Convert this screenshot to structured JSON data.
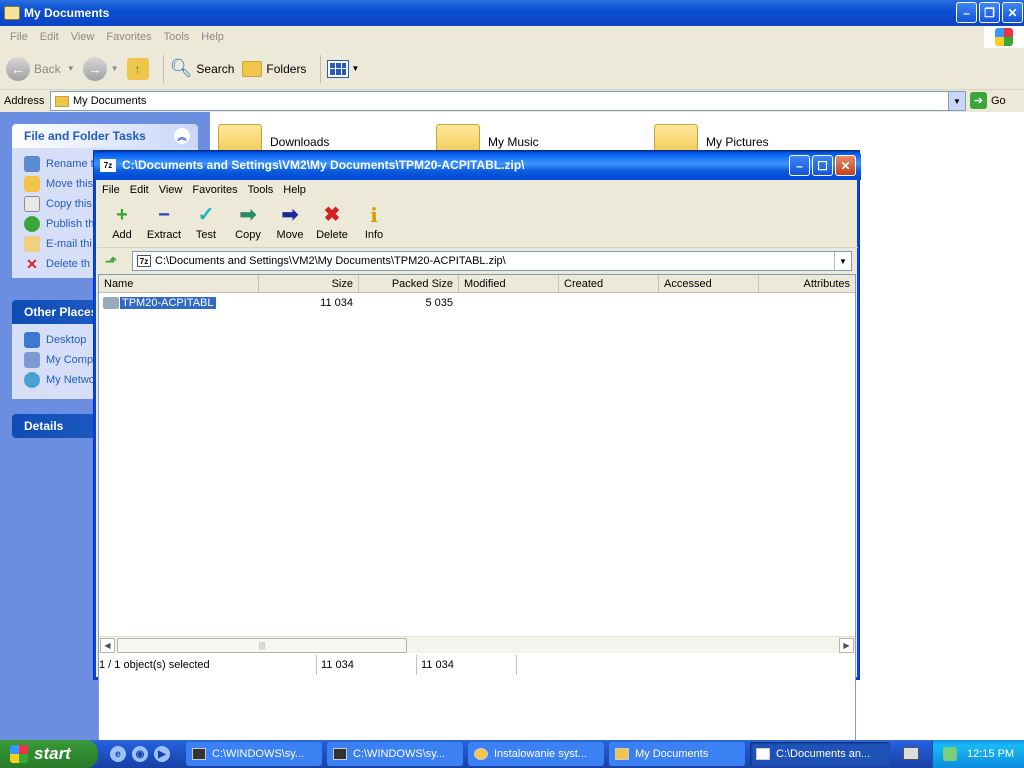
{
  "explorer": {
    "title": "My Documents",
    "menu": [
      "File",
      "Edit",
      "View",
      "Favorites",
      "Tools",
      "Help"
    ],
    "toolbar": {
      "back": "Back",
      "search": "Search",
      "folders": "Folders"
    },
    "address_label": "Address",
    "address_value": "My Documents",
    "go": "Go",
    "tasks_header": "File and Folder Tasks",
    "tasks": [
      "Rename this",
      "Move this",
      "Copy this",
      "Publish th",
      "E-mail thi",
      "Delete th"
    ],
    "other_header": "Other Places",
    "other": [
      "Desktop",
      "My Comp",
      "My Netwo"
    ],
    "details_header": "Details",
    "folders": [
      "Downloads",
      "My Music",
      "My Pictures"
    ]
  },
  "zip": {
    "title": "C:\\Documents and Settings\\VM2\\My Documents\\TPM20-ACPITABL.zip\\",
    "logo": "7z",
    "menu": [
      "File",
      "Edit",
      "View",
      "Favorites",
      "Tools",
      "Help"
    ],
    "tools": [
      {
        "label": "Add",
        "icon": "+",
        "color": "#2fa82f"
      },
      {
        "label": "Extract",
        "icon": "−",
        "color": "#1a3fbf"
      },
      {
        "label": "Test",
        "icon": "✓",
        "color": "#20b5b5"
      },
      {
        "label": "Copy",
        "icon": "➡",
        "color": "#2a8a6a"
      },
      {
        "label": "Move",
        "icon": "➡",
        "color": "#1a2a9a"
      },
      {
        "label": "Delete",
        "icon": "✖",
        "color": "#d42020"
      },
      {
        "label": "Info",
        "icon": "i",
        "color": "#d4a000"
      }
    ],
    "path": "C:\\Documents and Settings\\VM2\\My Documents\\TPM20-ACPITABL.zip\\",
    "columns": [
      "Name",
      "Size",
      "Packed Size",
      "Modified",
      "Created",
      "Accessed",
      "Attributes"
    ],
    "rows": [
      {
        "name": "TPM20-ACPITABL",
        "size": "11 034",
        "packed": "5 035"
      }
    ],
    "status": {
      "selected": "1 / 1 object(s) selected",
      "size": "11 034",
      "packed": "11 034"
    }
  },
  "taskbar": {
    "start": "start",
    "items": [
      "C:\\WINDOWS\\sy...",
      "C:\\WINDOWS\\sy...",
      "Instalowanie syst...",
      "My Documents",
      "C:\\Documents an..."
    ],
    "clock": "12:15 PM"
  }
}
